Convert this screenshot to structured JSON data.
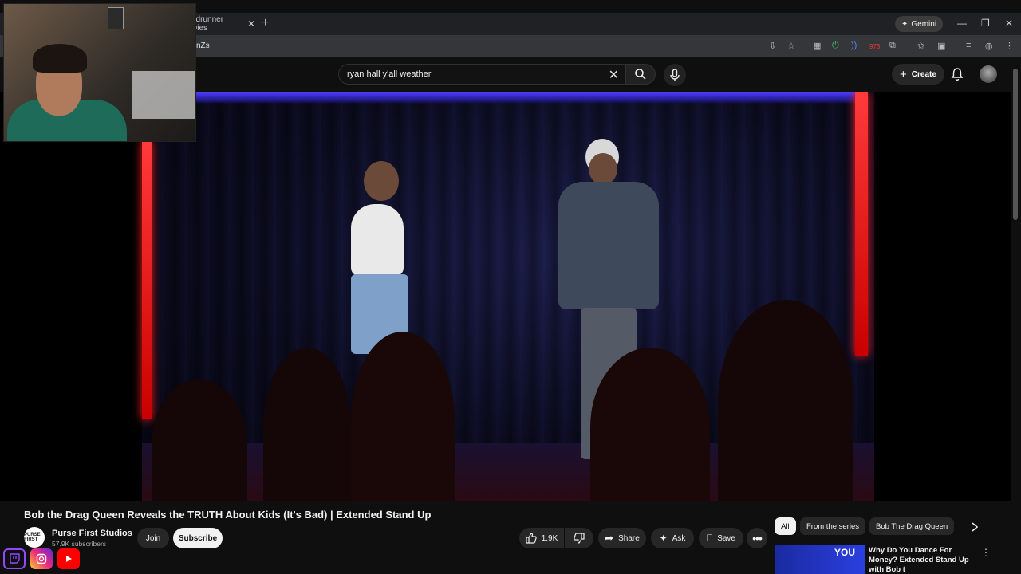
{
  "browser": {
    "tab_title": "edrunner Dies",
    "url_fragment": "nZs",
    "gemini_label": "Gemini",
    "badge_count": "976"
  },
  "header": {
    "search_value": "ryan hall y'all weather",
    "create_label": "Create"
  },
  "video": {
    "title": "Bob the Drag Queen Reveals the TRUTH About Kids (It's Bad) | Extended Stand Up"
  },
  "channel": {
    "avatar_text": "PURSE FIRST",
    "name": "Purse First Studios",
    "subscribers": "57.9K subscribers",
    "join_label": "Join",
    "subscribe_label": "Subscribe"
  },
  "actions": {
    "likes": "1.9K",
    "share_label": "Share",
    "ask_label": "Ask",
    "save_label": "Save"
  },
  "chips": [
    "All",
    "From the series",
    "Bob The Drag Queen"
  ],
  "recommendation": {
    "thumb_text": "YOU",
    "title": "Why Do You Dance For Money? Extended Stand Up with Bob t"
  },
  "colors": {
    "background": "#0f0f0f",
    "chip_active": "#f1f1f1",
    "neon": "#ff2020",
    "stage_blue": "#4b3cff"
  }
}
